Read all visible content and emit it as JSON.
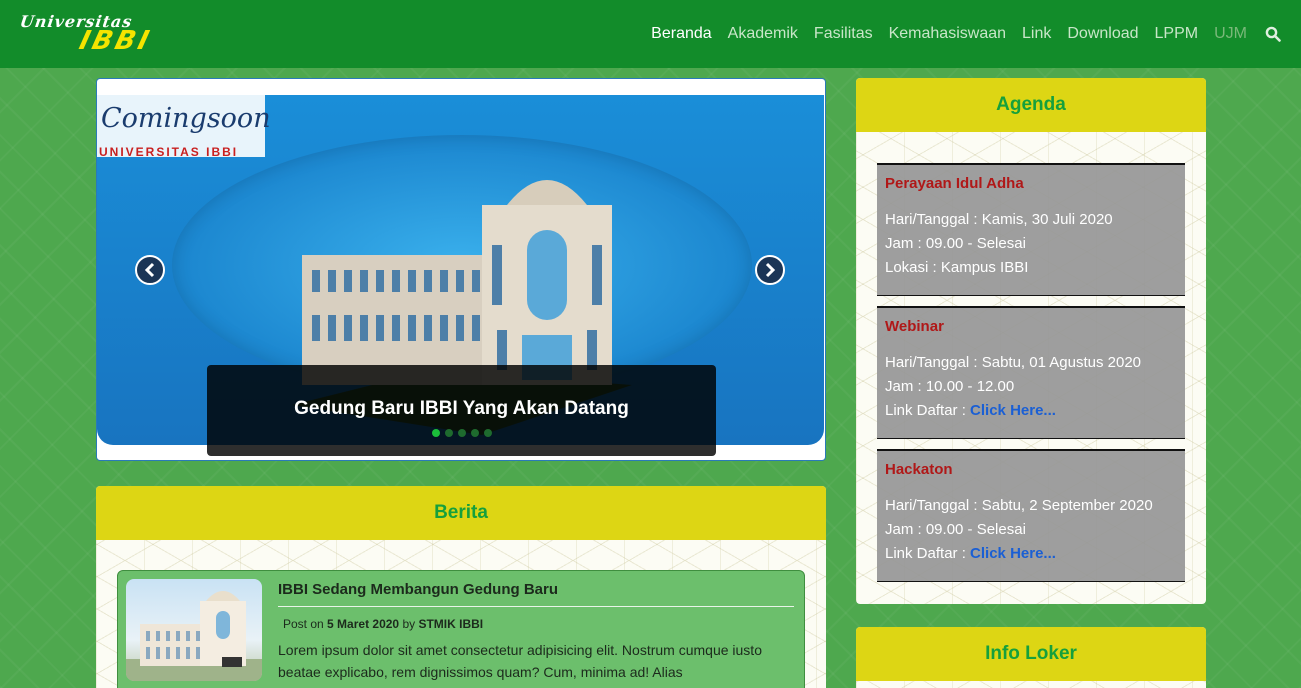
{
  "colors": {
    "navbar": "#128c2a",
    "background": "#4ea84e",
    "card_header": "#ddd614",
    "card_title": "#16a03c",
    "agenda_name": "#b01818",
    "link": "#1a5fd4"
  },
  "logo": {
    "line1": "Universitas",
    "line2": "IBBI"
  },
  "nav": {
    "items": [
      {
        "label": "Beranda",
        "state": "active"
      },
      {
        "label": "Akademik",
        "state": "normal"
      },
      {
        "label": "Fasilitas",
        "state": "normal"
      },
      {
        "label": "Kemahasiswaan",
        "state": "normal"
      },
      {
        "label": "Link",
        "state": "normal"
      },
      {
        "label": "Download",
        "state": "normal"
      },
      {
        "label": "LPPM",
        "state": "normal"
      },
      {
        "label": "UJM",
        "state": "muted"
      }
    ],
    "search_icon": "search-icon"
  },
  "slider": {
    "badge_title": "Comingsoon",
    "badge_subtitle": "UNIVERSITAS IBBI",
    "caption": "Gedung Baru IBBI Yang Akan Datang",
    "slide_count": 5,
    "active_index": 0,
    "prev_icon": "chevron-left-icon",
    "next_icon": "chevron-right-icon"
  },
  "berita": {
    "title": "Berita",
    "items": [
      {
        "title": "IBBI Sedang Membangun Gedung Baru",
        "meta_prefix": "Post on",
        "date": "5 Maret 2020",
        "meta_by": "by",
        "author": "STMIK IBBI",
        "excerpt": "Lorem ipsum dolor sit amet consectetur adipisicing elit. Nostrum cumque iusto beatae explicabo, rem dignissimos quam? Cum, minima ad! Alias"
      }
    ]
  },
  "agenda": {
    "title": "Agenda",
    "items": [
      {
        "name": "Perayaan Idul Adha",
        "lines": [
          "Hari/Tanggal : Kamis, 30 Juli 2020",
          "Jam : 09.00 - Selesai",
          "Lokasi : Kampus IBBI"
        ]
      },
      {
        "name": "Webinar",
        "lines": [
          "Hari/Tanggal : Sabtu, 01 Agustus 2020",
          "Jam : 10.00 - 12.00"
        ],
        "link_prefix": "Link Daftar :",
        "link_label": "Click Here..."
      },
      {
        "name": "Hackaton",
        "lines": [
          "Hari/Tanggal : Sabtu, 2 September 2020",
          "Jam : 09.00 - Selesai"
        ],
        "link_prefix": "Link Daftar :",
        "link_label": "Click Here..."
      }
    ]
  },
  "loker": {
    "title": "Info Loker"
  }
}
